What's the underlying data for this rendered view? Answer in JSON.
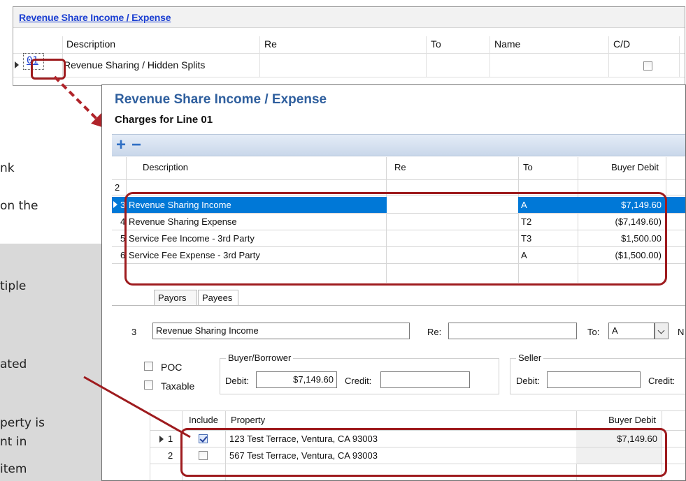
{
  "doc_fragments": [
    "nk",
    "on the",
    "tiple",
    "ated",
    "perty is",
    "nt in",
    "item"
  ],
  "top_window": {
    "title": "Revenue Share Income / Expense",
    "columns": [
      "Description",
      "Re",
      "To",
      "Name",
      "C/D"
    ],
    "row": {
      "line": "01",
      "description": "Revenue Sharing / Hidden Splits",
      "cd_checked": false
    }
  },
  "child_window": {
    "title": "Revenue Share Income / Expense",
    "subtitle": "Charges for Line 01",
    "toolbar": {
      "add_symbol": "+",
      "remove_symbol": "−"
    },
    "columns": [
      "Description",
      "Re",
      "To",
      "Buyer Debit"
    ],
    "rows": [
      {
        "num": "2",
        "description": "",
        "re": "",
        "to": "",
        "buyer_debit": ""
      },
      {
        "num": "3",
        "description": "Revenue Sharing Income",
        "re": "",
        "to": "A",
        "buyer_debit": "$7,149.60"
      },
      {
        "num": "4",
        "description": "Revenue Sharing Expense",
        "re": "",
        "to": "T2",
        "buyer_debit": "($7,149.60)"
      },
      {
        "num": "5",
        "description": "Service Fee Income - 3rd Party",
        "re": "",
        "to": "T3",
        "buyer_debit": "$1,500.00"
      },
      {
        "num": "6",
        "description": "Service Fee Expense - 3rd Party",
        "re": "",
        "to": "A",
        "buyer_debit": "($1,500.00)"
      }
    ],
    "tabs": [
      "Payors",
      "Payees"
    ],
    "detail": {
      "num": "3",
      "description": "Revenue Sharing Income",
      "re_label": "Re:",
      "re_value": "",
      "to_label": "To:",
      "to_value": "A",
      "trailing_label": "N",
      "poc_label": "POC",
      "taxable_label": "Taxable",
      "buyer_group": "Buyer/Borrower",
      "seller_group": "Seller",
      "debit_label": "Debit:",
      "credit_label": "Credit:",
      "buyer_debit": "$7,149.60",
      "buyer_credit": "",
      "seller_debit": "",
      "seller_credit_label": "Credit:"
    },
    "property_grid": {
      "columns": [
        "Include",
        "Property",
        "Buyer Debit"
      ],
      "rows": [
        {
          "num": "1",
          "include": true,
          "property": "123 Test Terrace, Ventura, CA 93003",
          "buyer_debit": "$7,149.60"
        },
        {
          "num": "2",
          "include": false,
          "property": "567 Test Terrace, Ventura, CA 93003",
          "buyer_debit": ""
        }
      ]
    }
  },
  "colors": {
    "highlight": "#9e1b1e",
    "selection": "#0078d7",
    "link": "#1b3fd1",
    "title": "#2f5f9e"
  }
}
